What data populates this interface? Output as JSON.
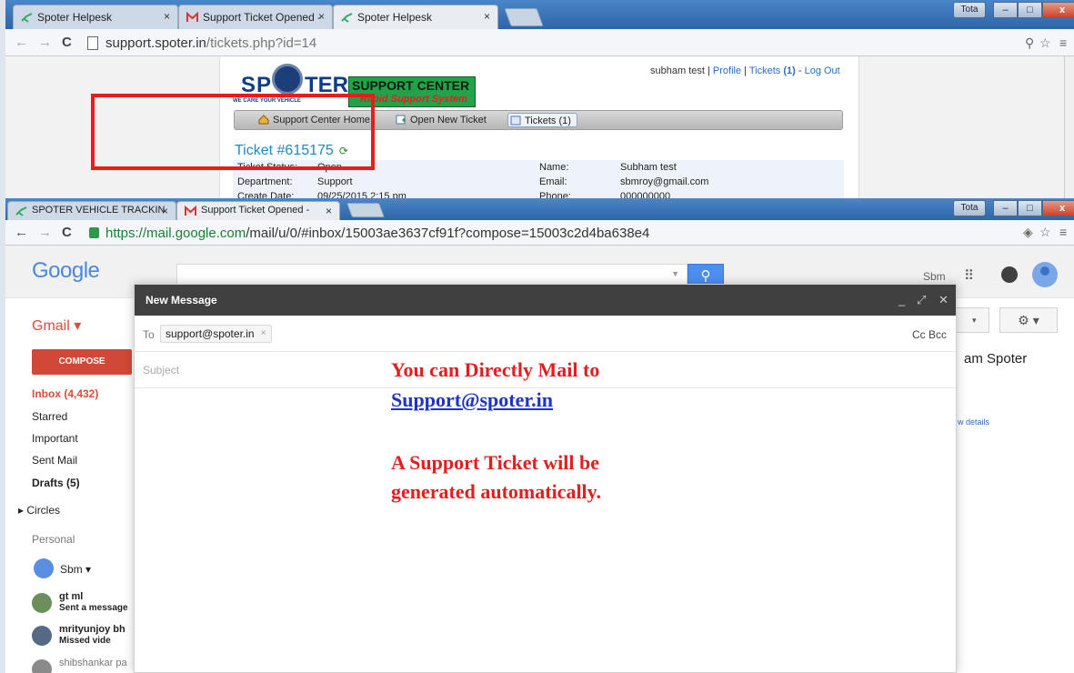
{
  "window1": {
    "tabs": [
      {
        "label": "Spoter Helpesk",
        "close": "×"
      },
      {
        "label": "Support Ticket Opened - ",
        "close": "×"
      },
      {
        "label": "Spoter Helpesk",
        "close": "×"
      }
    ],
    "user_badge": "Tota",
    "window_buttons": {
      "min": "–",
      "max": "□",
      "close": "x"
    },
    "url_main": "support.spoter.in",
    "url_rest": "/tickets.php?id=14",
    "logo": {
      "sp": "SP",
      "ter": "TER",
      "tagline": "WE CARE YOUR VEHICLE",
      "box_line1": "SUPPORT CENTER",
      "box_line2": "Rapid Support System"
    },
    "user_links": {
      "name": "subham test",
      "sep1": " | ",
      "profile": "Profile",
      "sep2": " | ",
      "tickets": "Tickets",
      "tickets_count": " (1)",
      "sep3": " - ",
      "logout": "Log Out"
    },
    "nav": [
      {
        "label": "Support Center Home"
      },
      {
        "label": "Open New Ticket"
      },
      {
        "label": "Tickets (1)"
      }
    ],
    "ticket_title": "Ticket #615175",
    "ticket_refresh_icon": "refresh-icon",
    "ticket_info": {
      "status_label": "Ticket Status:",
      "status_value": "Open",
      "department_label": "Department:",
      "department_value": "Support",
      "create_label": "Create Date:",
      "create_value": "09/25/2015 2:15 pm",
      "name_label": "Name:",
      "name_value": "Subham test",
      "email_label": "Email:",
      "email_value": "sbmroy@gmail.com",
      "phone_label": "Phone:",
      "phone_value": "000000000"
    }
  },
  "window2": {
    "tabs": [
      {
        "label": "SPOTER VEHICLE TRACKIN",
        "close": "×"
      },
      {
        "label": "Support Ticket Opened - ",
        "close": "×"
      }
    ],
    "user_badge": "Tota",
    "window_buttons": {
      "min": "–",
      "max": "□",
      "close": "x"
    },
    "url_scheme_host": "https://mail.google.com",
    "url_rest": "/mail/u/0/#inbox/15003ae3637cf91f?compose=15003c2d4ba638e4",
    "google_logo": "Google",
    "search_placeholder": "",
    "search_dropdown": "▼",
    "user_short": "Sbm",
    "gmail_label": "Gmail ▾",
    "compose_label": "COMPOSE",
    "left_nav": [
      {
        "label": "Inbox (4,432)"
      },
      {
        "label": "Starred"
      },
      {
        "label": "Important"
      },
      {
        "label": "Sent Mail"
      },
      {
        "label": "Drafts (5)"
      },
      {
        "label": "▸ Circles"
      },
      {
        "label": "Personal"
      }
    ],
    "hangouts_user": "Sbm ▾",
    "hangouts": [
      {
        "name": "gt ml",
        "status": "Sent a message"
      },
      {
        "name": "mrityunjoy bh",
        "status": "Missed vide"
      },
      {
        "name": "shibshankar pa",
        "status": ""
      }
    ],
    "right_name": "am Spoter",
    "right_details": "w details",
    "settings_label": "⚙ ▾",
    "compose_window": {
      "title": "New Message",
      "ctl_min": "_",
      "ctl_expand": "⤢",
      "ctl_close": "✕",
      "to_label": "To",
      "recipient": "support@spoter.in",
      "recipient_remove": "×",
      "cc_bcc": "Cc Bcc",
      "subject_placeholder": "Subject"
    }
  },
  "annotation": {
    "line1": "You can Directly  Mail to",
    "line2": "Support@spoter.in",
    "line3": "A Support Ticket will be",
    "line4": "generated automatically."
  },
  "colors": {
    "annotation_red": "#e31e1e",
    "gmail_red": "#dd4b39",
    "google_blue": "#4a86e8"
  }
}
